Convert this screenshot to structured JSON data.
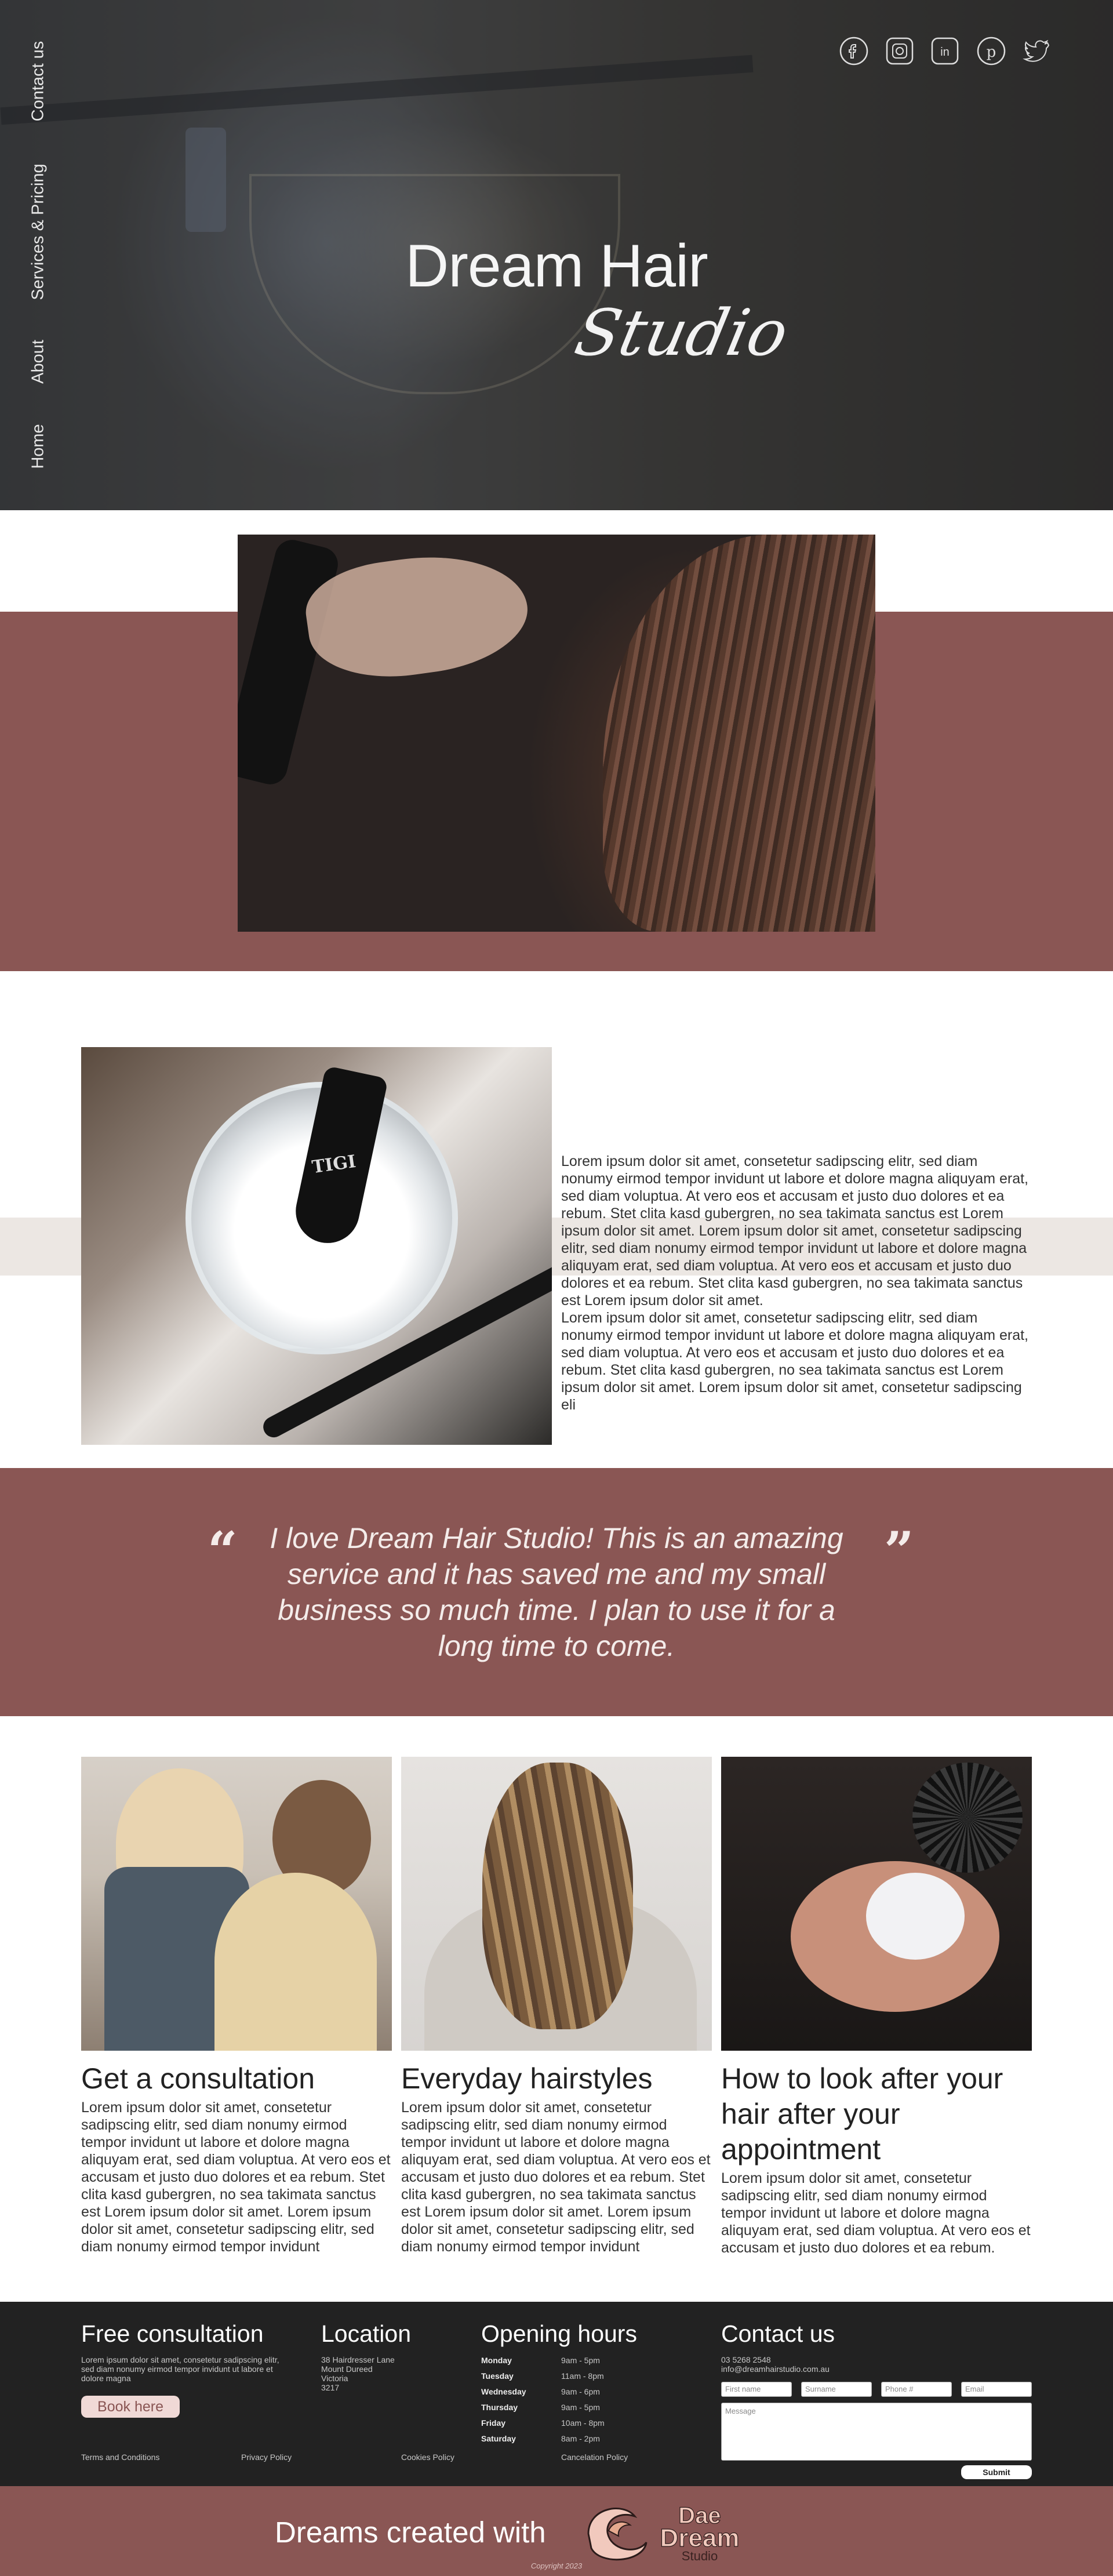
{
  "hero": {
    "title": "Dream Hair",
    "subtitle": "Studio",
    "nav": [
      "Contact us",
      "Services & Pricing",
      "About",
      "Home"
    ],
    "social_icons": [
      "facebook-icon",
      "instagram-icon",
      "linkedin-icon",
      "pinterest-icon",
      "twitter-icon"
    ]
  },
  "about": {
    "paragraph": "Lorem ipsum dolor sit amet, consetetur sadipscing elitr, sed diam nonumy eirmod tempor invidunt ut labore et dolore magna aliquyam erat, sed diam voluptua. At vero eos et accusam et justo duo dolores et ea rebum. Stet clita kasd gubergren, no sea takimata sanctus est Lorem ipsum dolor sit amet. Lorem ipsum dolor sit amet, consetetur sadipscing elitr, sed diam nonumy eirmod tempor invidunt ut labore et dolore magna aliquyam erat, sed diam voluptua. At vero eos et accusam et justo duo dolores et ea rebum. Stet clita kasd gubergren, no sea takimata sanctus est Lorem ipsum dolor sit amet.",
    "paragraph2": "Lorem ipsum dolor sit amet, consetetur sadipscing elitr, sed diam nonumy eirmod tempor invidunt ut labore et dolore magna aliquyam erat, sed diam voluptua. At vero eos et accusam et justo duo dolores et ea rebum. Stet clita kasd gubergren, no sea takimata sanctus est Lorem ipsum dolor sit amet. Lorem ipsum dolor sit amet, consetetur sadipscing eli",
    "tigi": "TIGI"
  },
  "testimonial": {
    "open_quote": "“",
    "close_quote": "”",
    "text": "I love Dream Hair Studio! This is an amazing service and it has saved me and my small business so much time. I plan to use it for a long time to come."
  },
  "cards": [
    {
      "title": "Get a consultation",
      "body": "Lorem ipsum dolor sit amet, consetetur sadipscing elitr, sed diam nonumy eirmod tempor invidunt ut labore et dolore magna aliquyam erat, sed diam voluptua. At vero eos et accusam et justo duo dolores et ea rebum. Stet clita kasd gubergren, no sea takimata sanctus est Lorem ipsum dolor sit amet. Lorem ipsum dolor sit amet, consetetur sadipscing elitr, sed diam nonumy eirmod tempor invidunt"
    },
    {
      "title": "Everyday hairstyles",
      "body": "Lorem ipsum dolor sit amet, consetetur sadipscing elitr, sed diam nonumy eirmod tempor invidunt ut labore et dolore magna aliquyam erat, sed diam voluptua. At vero eos et accusam et justo duo dolores et ea rebum. Stet clita kasd gubergren, no sea takimata sanctus est Lorem ipsum dolor sit amet. Lorem ipsum dolor sit amet, consetetur sadipscing elitr, sed diam nonumy eirmod tempor invidunt"
    },
    {
      "title": "How to look after your hair after your appointment",
      "body": "Lorem ipsum dolor sit amet, consetetur sadipscing elitr, sed diam nonumy eirmod tempor invidunt ut labore et dolore magna aliquyam erat, sed diam voluptua. At vero eos et accusam et justo duo dolores et ea rebum."
    }
  ],
  "footer": {
    "consult_title": "Free consultation",
    "consult_text": "Lorem ipsum dolor sit amet, consetetur sadipscing elitr, sed diam nonumy eirmod tempor invidunt ut labore et dolore magna",
    "book_label": "Book here",
    "location_title": "Location",
    "address": [
      "38 Hairdresser Lane",
      "Mount Dureed",
      "Victoria",
      "3217"
    ],
    "hours_title": "Opening hours",
    "hours": [
      {
        "day": "Monday",
        "time": "9am - 5pm"
      },
      {
        "day": "Tuesday",
        "time": "11am - 8pm"
      },
      {
        "day": "Wednesday",
        "time": "9am - 6pm"
      },
      {
        "day": "Thursday",
        "time": "9am - 5pm"
      },
      {
        "day": "Friday",
        "time": "10am - 8pm"
      },
      {
        "day": "Saturday",
        "time": "8am - 2pm"
      }
    ],
    "contact_title": "Contact us",
    "phone": "03 5268 2548",
    "email": "info@dreamhairstudio.com.au",
    "fields": {
      "first": "First name",
      "surname": "Surname",
      "phone": "Phone #",
      "email": "Email",
      "message": "Message"
    },
    "submit_label": "Submit",
    "links": [
      "Terms and Conditions",
      "Privacy Policy",
      "Cookies Policy",
      "Cancelation Policy"
    ]
  },
  "bottom": {
    "dreams": "Dreams created with",
    "logo_line1": "Dae",
    "logo_line2": "Dream",
    "logo_line3": "Studio",
    "copyright": "Copyright 2023"
  },
  "colors": {
    "maroon": "#8a5654",
    "footer_bg": "#222222",
    "strip": "#ece7e3",
    "button_bg": "#f0d9d6"
  }
}
